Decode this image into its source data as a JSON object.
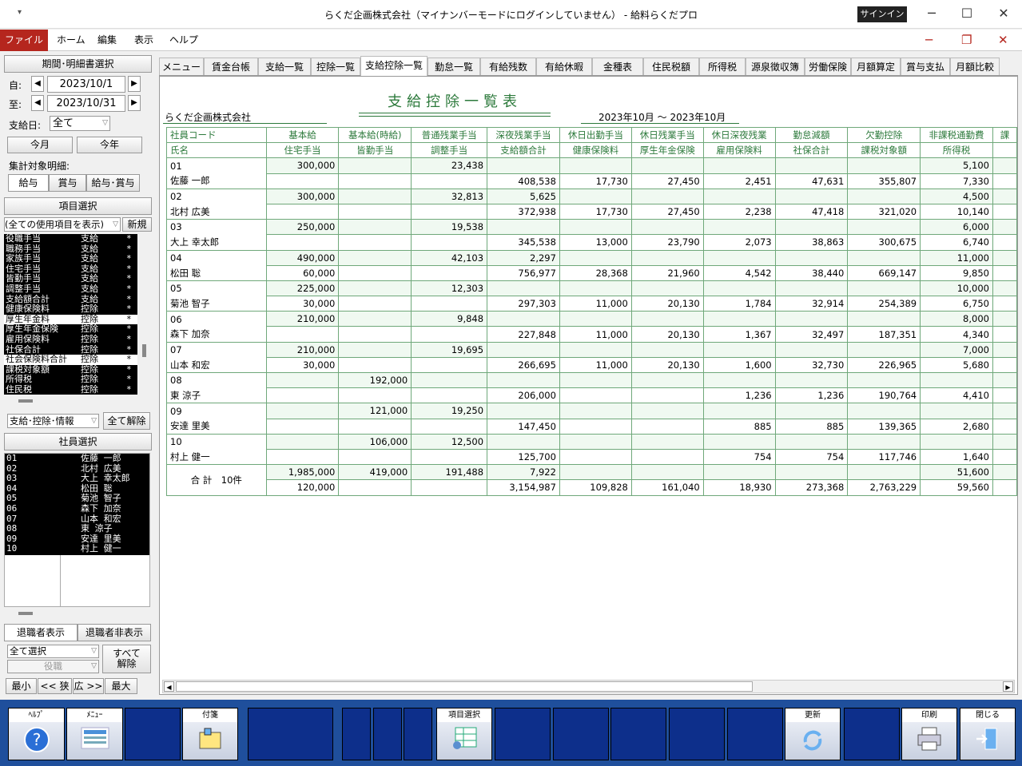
{
  "window": {
    "title": "らくだ企画株式会社（マイナンバーモードにログインしていません） - 給料らくだプロ",
    "signin": "サインイン",
    "qa": "▾",
    "min": "─",
    "max": "☐",
    "close": "✕"
  },
  "menu": {
    "file": "ファイル",
    "items": [
      "ホーム",
      "編集",
      "表示",
      "ヘルプ"
    ],
    "rmin": "─",
    "rrestore": "❐",
    "rclose": "✕"
  },
  "left": {
    "period_header": "期間･明細書選択",
    "from_label": "自:",
    "from_value": "2023/10/1",
    "to_label": "至:",
    "to_value": "2023/10/31",
    "payday_label": "支給日:",
    "payday_value": "全て",
    "this_month": "今月",
    "this_year": "今年",
    "target_label": "集計対象明細:",
    "target_opts": [
      "給与",
      "賞与",
      "給与･賞与"
    ],
    "item_header": "項目選択",
    "item_filter": "(全ての使用項目を表示)",
    "item_new": "新規",
    "items": [
      {
        "name": "役職手当",
        "kind": "支給",
        "mark": "*",
        "sel": false
      },
      {
        "name": "職務手当",
        "kind": "支給",
        "mark": "*",
        "sel": false
      },
      {
        "name": "家族手当",
        "kind": "支給",
        "mark": "*",
        "sel": false
      },
      {
        "name": "住宅手当",
        "kind": "支給",
        "mark": "*",
        "sel": false
      },
      {
        "name": "皆勤手当",
        "kind": "支給",
        "mark": "*",
        "sel": false
      },
      {
        "name": "調整手当",
        "kind": "支給",
        "mark": "*",
        "sel": false
      },
      {
        "name": "支給額合計",
        "kind": "支給",
        "mark": "*",
        "sel": false
      },
      {
        "name": "健康保険料",
        "kind": "控除",
        "mark": "*",
        "sel": false
      },
      {
        "name": "厚生年金料",
        "kind": "控除",
        "mark": "*",
        "sel": true
      },
      {
        "name": "厚生年金保険",
        "kind": "控除",
        "mark": "*",
        "sel": false
      },
      {
        "name": "雇用保険料",
        "kind": "控除",
        "mark": "*",
        "sel": false
      },
      {
        "name": "社保合計",
        "kind": "控除",
        "mark": "*",
        "sel": false
      },
      {
        "name": "社会保険料合計",
        "kind": "控除",
        "mark": "*",
        "sel": true
      },
      {
        "name": "課税対象額",
        "kind": "控除",
        "mark": "*",
        "sel": false
      },
      {
        "name": "所得税",
        "kind": "控除",
        "mark": "*",
        "sel": false
      },
      {
        "name": "住民税",
        "kind": "控除",
        "mark": "*",
        "sel": false
      }
    ],
    "cat_select": "支給･控除･情報",
    "clear_all": "全て解除",
    "emp_header": "社員選択",
    "employees": [
      [
        "01",
        "佐藤 一郎"
      ],
      [
        "02",
        "北村 広美"
      ],
      [
        "03",
        "大上 幸太郎"
      ],
      [
        "04",
        "松田 聡"
      ],
      [
        "05",
        "菊池 智子"
      ],
      [
        "06",
        "森下 加奈"
      ],
      [
        "07",
        "山本 和宏"
      ],
      [
        "08",
        "東 涼子"
      ],
      [
        "09",
        "安達 里美"
      ],
      [
        "10",
        "村上 健一"
      ]
    ],
    "show_retired": "退職者表示",
    "hide_retired": "退職者非表示",
    "sel_all": "全て選択",
    "post": "役職",
    "unselect": "すべて\n解除",
    "zoom": [
      "最小",
      "<< 狭",
      "広 >>",
      "最大"
    ]
  },
  "tabs": [
    "メニュー",
    "賃金台帳",
    "支給一覧",
    "控除一覧",
    "支給控除一覧",
    "勤怠一覧",
    "有給残数",
    "有給休暇",
    "金種表",
    "住民税額",
    "所得税",
    "源泉徴収簿",
    "労働保険",
    "月額算定",
    "賞与支払",
    "月額比較"
  ],
  "report": {
    "title": "支給控除一覧表",
    "company": "らくだ企画株式会社",
    "period": "2023年10月 ～ 2023年10月",
    "head1": [
      "社員コード",
      "基本給",
      "基本給(時給)",
      "普通残業手当",
      "深夜残業手当",
      "休日出勤手当",
      "休日残業手当",
      "休日深夜残業",
      "勤怠減額",
      "欠勤控除",
      "非課税通勤費",
      "課"
    ],
    "head2": [
      "氏名",
      "住宅手当",
      "皆勤手当",
      "調整手当",
      "支給額合計",
      "健康保険料",
      "厚生年金保険",
      "雇用保険料",
      "社保合計",
      "課税対象額",
      "所得税",
      ""
    ],
    "rows": [
      {
        "code": "01",
        "name": "佐藤 一郎",
        "a": [
          "300,000",
          "",
          "23,438",
          "",
          "",
          "",
          "",
          "",
          "",
          "5,100",
          ""
        ],
        "b": [
          "",
          "",
          "",
          "408,538",
          "17,730",
          "27,450",
          "2,451",
          "47,631",
          "355,807",
          "7,330",
          ""
        ]
      },
      {
        "code": "02",
        "name": "北村 広美",
        "a": [
          "300,000",
          "",
          "32,813",
          "5,625",
          "",
          "",
          "",
          "",
          "",
          "4,500",
          ""
        ],
        "b": [
          "",
          "",
          "",
          "372,938",
          "17,730",
          "27,450",
          "2,238",
          "47,418",
          "321,020",
          "10,140",
          ""
        ]
      },
      {
        "code": "03",
        "name": "大上 幸太郎",
        "a": [
          "250,000",
          "",
          "19,538",
          "",
          "",
          "",
          "",
          "",
          "",
          "6,000",
          ""
        ],
        "b": [
          "",
          "",
          "",
          "345,538",
          "13,000",
          "23,790",
          "2,073",
          "38,863",
          "300,675",
          "6,740",
          ""
        ]
      },
      {
        "code": "04",
        "name": "松田 聡",
        "a": [
          "490,000",
          "",
          "42,103",
          "2,297",
          "",
          "",
          "",
          "",
          "",
          "11,000",
          ""
        ],
        "b": [
          "60,000",
          "",
          "",
          "756,977",
          "28,368",
          "21,960",
          "4,542",
          "38,440",
          "669,147",
          "9,850",
          ""
        ]
      },
      {
        "code": "05",
        "name": "菊池 智子",
        "a": [
          "225,000",
          "",
          "12,303",
          "",
          "",
          "",
          "",
          "",
          "",
          "10,000",
          ""
        ],
        "b": [
          "30,000",
          "",
          "",
          "297,303",
          "11,000",
          "20,130",
          "1,784",
          "32,914",
          "254,389",
          "6,750",
          ""
        ]
      },
      {
        "code": "06",
        "name": "森下 加奈",
        "a": [
          "210,000",
          "",
          "9,848",
          "",
          "",
          "",
          "",
          "",
          "",
          "8,000",
          ""
        ],
        "b": [
          "",
          "",
          "",
          "227,848",
          "11,000",
          "20,130",
          "1,367",
          "32,497",
          "187,351",
          "4,340",
          ""
        ]
      },
      {
        "code": "07",
        "name": "山本 和宏",
        "a": [
          "210,000",
          "",
          "19,695",
          "",
          "",
          "",
          "",
          "",
          "",
          "7,000",
          ""
        ],
        "b": [
          "30,000",
          "",
          "",
          "266,695",
          "11,000",
          "20,130",
          "1,600",
          "32,730",
          "226,965",
          "5,680",
          ""
        ]
      },
      {
        "code": "08",
        "name": "東 涼子",
        "a": [
          "",
          "192,000",
          "",
          "",
          "",
          "",
          "",
          "",
          "",
          "",
          ""
        ],
        "b": [
          "",
          "",
          "",
          "206,000",
          "",
          "",
          "1,236",
          "1,236",
          "190,764",
          "4,410",
          ""
        ]
      },
      {
        "code": "09",
        "name": "安達 里美",
        "a": [
          "",
          "121,000",
          "19,250",
          "",
          "",
          "",
          "",
          "",
          "",
          "",
          ""
        ],
        "b": [
          "",
          "",
          "",
          "147,450",
          "",
          "",
          "885",
          "885",
          "139,365",
          "2,680",
          ""
        ]
      },
      {
        "code": "10",
        "name": "村上 健一",
        "a": [
          "",
          "106,000",
          "12,500",
          "",
          "",
          "",
          "",
          "",
          "",
          "",
          ""
        ],
        "b": [
          "",
          "",
          "",
          "125,700",
          "",
          "",
          "754",
          "754",
          "117,746",
          "1,640",
          ""
        ]
      }
    ],
    "total_label": "合 計　10件",
    "total_a": [
      "1,985,000",
      "419,000",
      "191,488",
      "7,922",
      "",
      "",
      "",
      "",
      "",
      "51,600",
      ""
    ],
    "total_b": [
      "120,000",
      "",
      "",
      "3,154,987",
      "109,828",
      "161,040",
      "18,930",
      "273,368",
      "2,763,229",
      "59,560",
      ""
    ]
  },
  "fkeys": [
    {
      "label": "ﾍﾙﾌﾟ",
      "icon": "help-icon"
    },
    {
      "label": "ﾒﾆｭｰ",
      "icon": "menu-icon"
    },
    {
      "label": "",
      "icon": ""
    },
    {
      "label": "付箋",
      "icon": "sticky-note-icon"
    },
    {
      "label": "",
      "icon": ""
    },
    {
      "label": "",
      "icon": ""
    },
    {
      "label": "",
      "icon": ""
    },
    {
      "label": "",
      "icon": ""
    },
    {
      "label": "項目選択",
      "icon": "item-select-icon"
    },
    {
      "label": "",
      "icon": ""
    },
    {
      "label": "",
      "icon": ""
    },
    {
      "label": "",
      "icon": ""
    },
    {
      "label": "",
      "icon": ""
    },
    {
      "label": "",
      "icon": ""
    },
    {
      "label": "更新",
      "icon": "refresh-icon"
    },
    {
      "label": "",
      "icon": ""
    },
    {
      "label": "印刷",
      "icon": "print-icon"
    },
    {
      "label": "閉じる",
      "icon": "exit-icon"
    }
  ]
}
